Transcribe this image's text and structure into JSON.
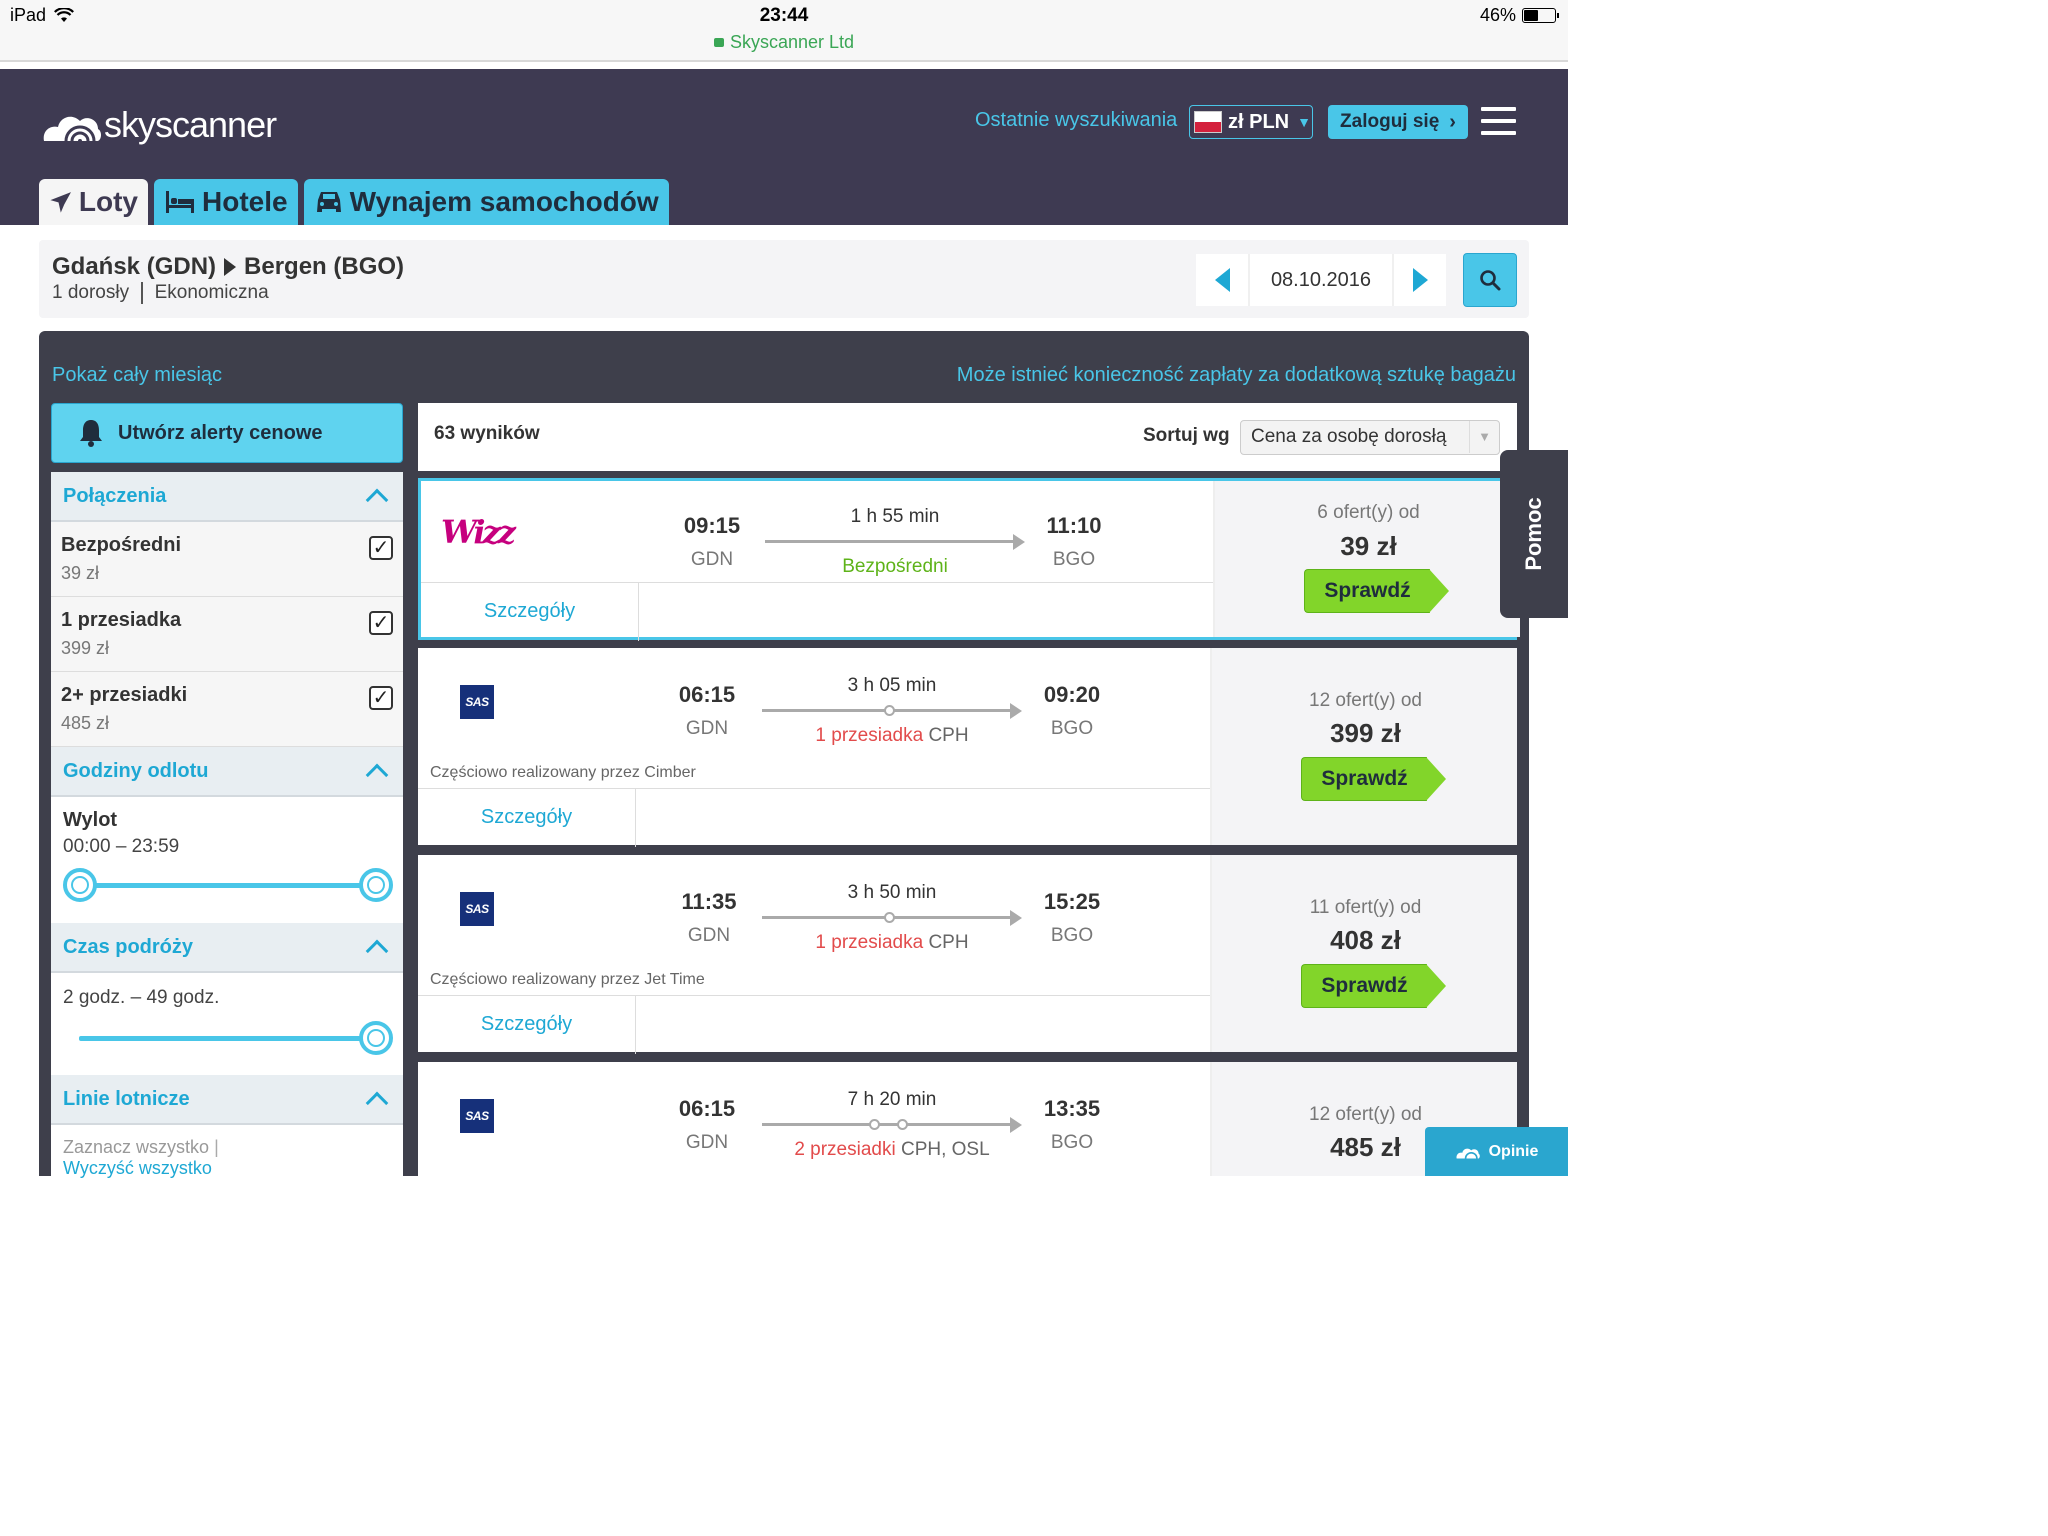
{
  "status_bar": {
    "device": "iPad",
    "time": "23:44",
    "site": "Skyscanner Ltd",
    "battery": "46%"
  },
  "header": {
    "logo_text": "skyscanner",
    "recent_searches": "Ostatnie wyszukiwania",
    "currency": "zł PLN",
    "login": "Zaloguj się",
    "tabs": [
      {
        "label": "Loty",
        "icon": "plane-icon"
      },
      {
        "label": "Hotele",
        "icon": "bed-icon"
      },
      {
        "label": "Wynajem samochodów",
        "icon": "car-icon"
      }
    ]
  },
  "search": {
    "from": "Gdańsk (GDN)",
    "to": "Bergen (BGO)",
    "passengers": "1 dorosły",
    "cabin": "Ekonomiczna",
    "date": "08.10.2016"
  },
  "links": {
    "show_month": "Pokaż cały miesiąc",
    "baggage_notice": "Może istnieć konieczność zapłaty za dodatkową sztukę bagażu"
  },
  "sidebar": {
    "alert_button": "Utwórz alerty cenowe",
    "connections": {
      "title": "Połączenia",
      "items": [
        {
          "label": "Bezpośredni",
          "price": "39 zł",
          "checked": true
        },
        {
          "label": "1 przesiadka",
          "price": "399 zł",
          "checked": true
        },
        {
          "label": "2+ przesiadki",
          "price": "485 zł",
          "checked": true
        }
      ]
    },
    "departure": {
      "title": "Godziny odlotu",
      "label": "Wylot",
      "range": "00:00 – 23:59"
    },
    "duration": {
      "title": "Czas podróży",
      "range": "2 godz. – 49 godz."
    },
    "airlines": {
      "title": "Linie lotnicze",
      "select_all": "Zaznacz wszystko",
      "clear_all": "Wyczyść wszystko"
    }
  },
  "results": {
    "count": "63 wyników",
    "sort_label": "Sortuj wg",
    "sort_value": "Cena za osobę dorosłą",
    "details_label": "Szczegóły",
    "check_label": "Sprawdź",
    "items": [
      {
        "airline": "Wizz Air",
        "logo": "wizz",
        "dep_time": "09:15",
        "dep_code": "GDN",
        "duration": "1 h 55 min",
        "stops_label": "Bezpośredni",
        "stops_via": "",
        "arr_time": "11:10",
        "arr_code": "BGO",
        "operated": "",
        "offers": "6 ofert(y) od",
        "price": "39 zł"
      },
      {
        "airline": "SAS",
        "logo": "SAS",
        "dep_time": "06:15",
        "dep_code": "GDN",
        "duration": "3 h 05 min",
        "stops_label": "1 przesiadka",
        "stops_via": "CPH",
        "arr_time": "09:20",
        "arr_code": "BGO",
        "operated": "Częściowo realizowany przez Cimber",
        "offers": "12 ofert(y) od",
        "price": "399 zł"
      },
      {
        "airline": "SAS",
        "logo": "SAS",
        "dep_time": "11:35",
        "dep_code": "GDN",
        "duration": "3 h 50 min",
        "stops_label": "1 przesiadka",
        "stops_via": "CPH",
        "arr_time": "15:25",
        "arr_code": "BGO",
        "operated": "Częściowo realizowany przez Jet Time",
        "offers": "11 ofert(y) od",
        "price": "408 zł"
      },
      {
        "airline": "SAS",
        "logo": "SAS",
        "dep_time": "06:15",
        "dep_code": "GDN",
        "duration": "7 h 20 min",
        "stops_label": "2 przesiadki",
        "stops_via": "CPH, OSL",
        "arr_time": "13:35",
        "arr_code": "BGO",
        "operated": "",
        "offers": "12 ofert(y) od",
        "price": "485 zł"
      }
    ]
  },
  "help_tab": "Pomoc",
  "feedback_button": "Opinie",
  "colors": {
    "header_bg": "#3e3a52",
    "accent": "#49c6e8",
    "check_green": "#82d52a",
    "stop_red": "#e24b4b"
  }
}
